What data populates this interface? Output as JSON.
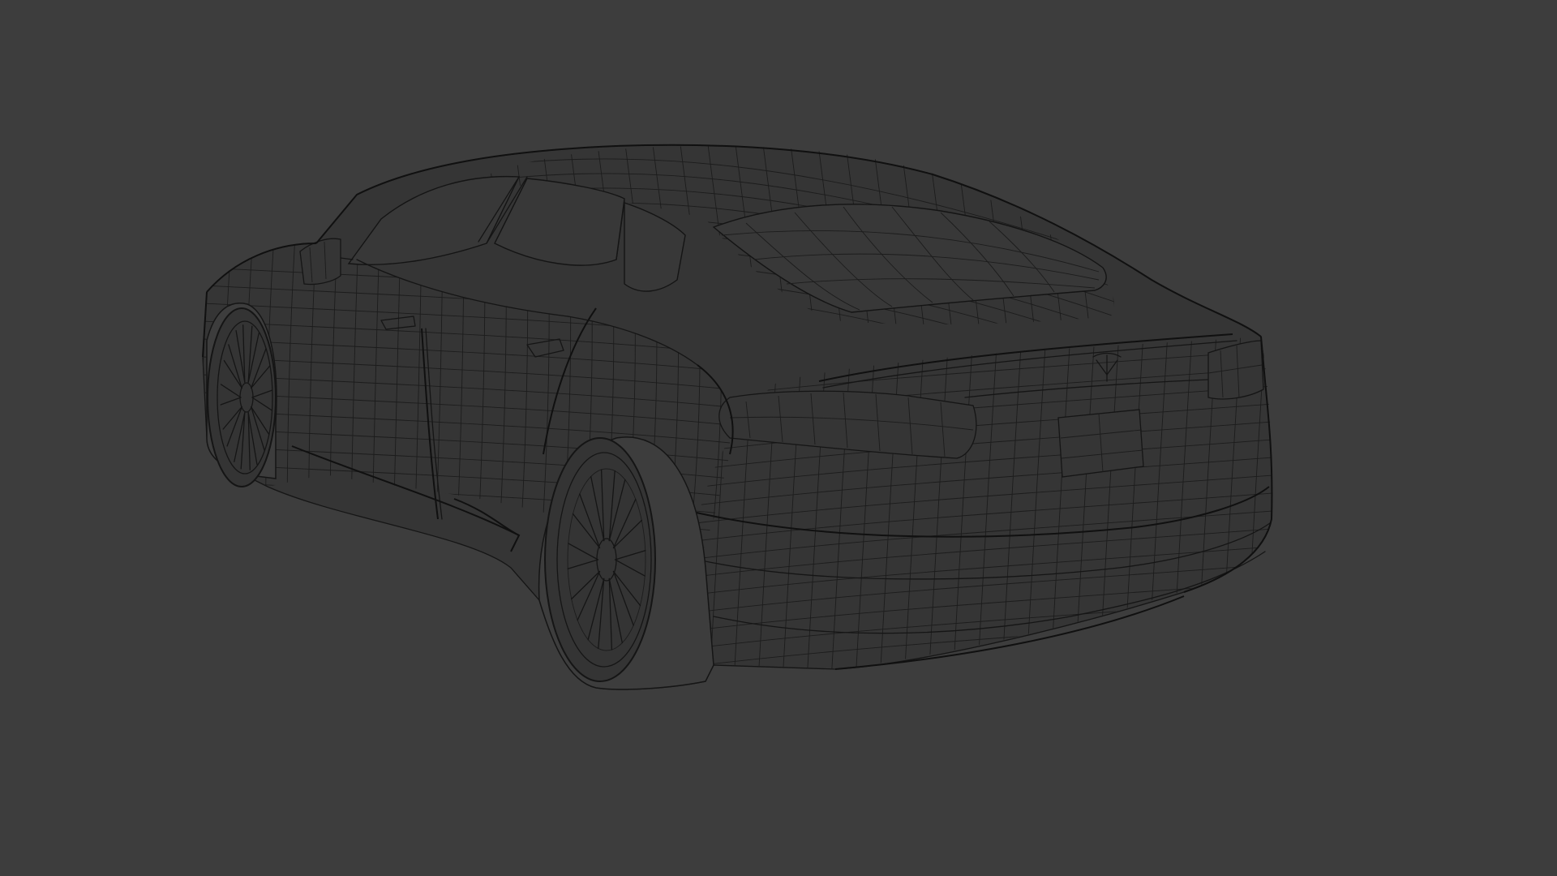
{
  "viewport": {
    "mode": "wireframe",
    "background_color": "#3d3d3d",
    "wire_color": "#151515",
    "subject": "car-rear-three-quarter"
  }
}
